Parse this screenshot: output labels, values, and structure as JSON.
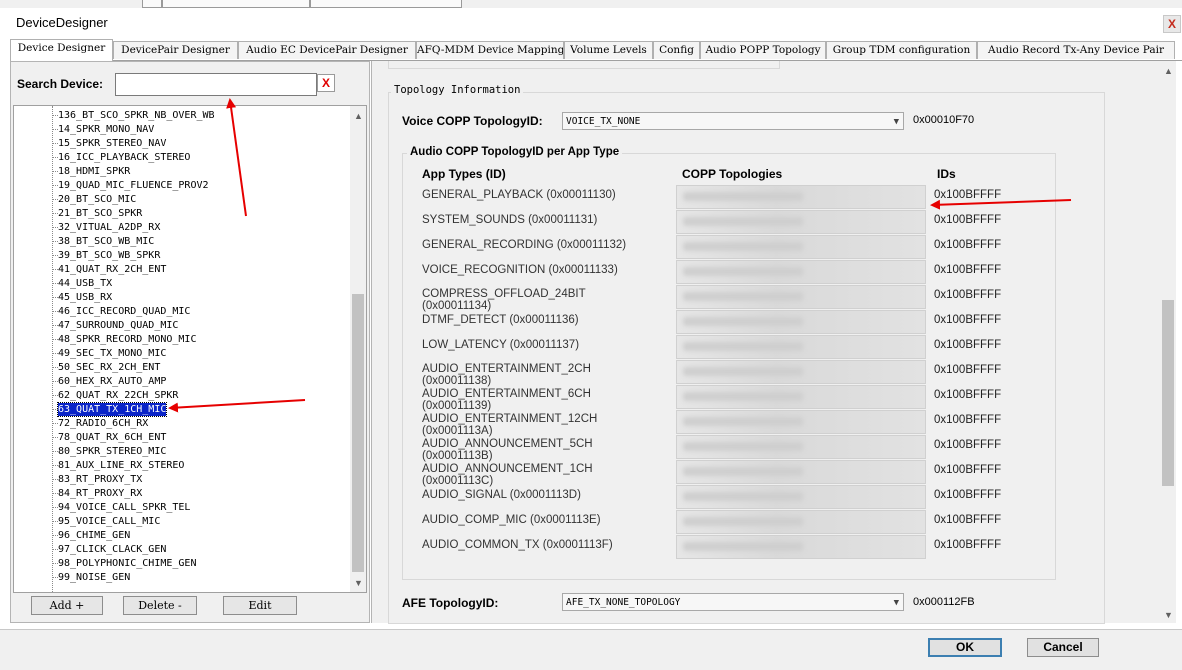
{
  "window": {
    "title": "DeviceDesigner",
    "close_label": "X"
  },
  "tabs": [
    "Device Designer",
    "DevicePair Designer",
    "Audio EC DevicePair Designer",
    "AFQ-MDM Device Mapping",
    "Volume Levels",
    "Config",
    "Audio POPP Topology",
    "Group TDM configuration",
    "Audio Record Tx-Any Device Pair"
  ],
  "search": {
    "label": "Search Device:",
    "value": "",
    "clear_label": "X"
  },
  "devices": [
    "136_BT_SCO_SPKR_NB_OVER_WB",
    "14_SPKR_MONO_NAV",
    "15_SPKR_STEREO_NAV",
    "16_ICC_PLAYBACK_STEREO",
    "18_HDMI_SPKR",
    "19_QUAD_MIC_FLUENCE_PROV2",
    "20_BT_SCO_MIC",
    "21_BT_SCO_SPKR",
    "32_VITUAL_A2DP_RX",
    "38_BT_SCO_WB_MIC",
    "39_BT_SCO_WB_SPKR",
    "41_QUAT_RX_2CH_ENT",
    "44_USB_TX",
    "45_USB_RX",
    "46_ICC_RECORD_QUAD_MIC",
    "47_SURROUND_QUAD_MIC",
    "48_SPKR_RECORD_MONO_MIC",
    "49_SEC_TX_MONO_MIC",
    "50_SEC_RX_2CH_ENT",
    "60_HEX_RX_AUTO_AMP",
    "62_QUAT_RX_22CH_SPKR",
    "63_QUAT_TX_1CH_MIC",
    "72_RADIO_6CH_RX",
    "78_QUAT_RX_6CH_ENT",
    "80_SPKR_STEREO_MIC",
    "81_AUX_LINE_RX_STEREO",
    "83_RT_PROXY_TX",
    "84_RT_PROXY_RX",
    "94_VOICE_CALL_SPKR_TEL",
    "95_VOICE_CALL_MIC",
    "96_CHIME_GEN",
    "97_CLICK_CLACK_GEN",
    "98_POLYPHONIC_CHIME_GEN",
    "99_NOISE_GEN"
  ],
  "selected_device": "63_QUAT_TX_1CH_MIC",
  "device_buttons": {
    "add": "Add +",
    "delete": "Delete -",
    "edit": "Edit"
  },
  "topology": {
    "group_label": "Topology Information",
    "voice_copp_label": "Voice COPP TopologyID:",
    "voice_copp_value": "VOICE_TX_NONE",
    "voice_copp_id": "0x00010F70",
    "audio_copp_group_label": "Audio COPP TopologyID per App Type",
    "col_app_types": "App Types (ID)",
    "col_copp": "COPP Topologies",
    "col_ids": "IDs",
    "app_types": [
      {
        "name": "GENERAL_PLAYBACK (0x00011130)",
        "id": "0x100BFFFF"
      },
      {
        "name": "SYSTEM_SOUNDS (0x00011131)",
        "id": "0x100BFFFF"
      },
      {
        "name": "GENERAL_RECORDING (0x00011132)",
        "id": "0x100BFFFF"
      },
      {
        "name": "VOICE_RECOGNITION (0x00011133)",
        "id": "0x100BFFFF"
      },
      {
        "name": "COMPRESS_OFFLOAD_24BIT (0x00011134)",
        "id": "0x100BFFFF"
      },
      {
        "name": "DTMF_DETECT (0x00011136)",
        "id": "0x100BFFFF"
      },
      {
        "name": "LOW_LATENCY (0x00011137)",
        "id": "0x100BFFFF"
      },
      {
        "name": "AUDIO_ENTERTAINMENT_2CH (0x00011138)",
        "id": "0x100BFFFF"
      },
      {
        "name": "AUDIO_ENTERTAINMENT_6CH (0x00011139)",
        "id": "0x100BFFFF"
      },
      {
        "name": "AUDIO_ENTERTAINMENT_12CH (0x0001113A)",
        "id": "0x100BFFFF"
      },
      {
        "name": "AUDIO_ANNOUNCEMENT_5CH (0x0001113B)",
        "id": "0x100BFFFF"
      },
      {
        "name": "AUDIO_ANNOUNCEMENT_1CH (0x0001113C)",
        "id": "0x100BFFFF"
      },
      {
        "name": "AUDIO_SIGNAL (0x0001113D)",
        "id": "0x100BFFFF"
      },
      {
        "name": "AUDIO_COMP_MIC (0x0001113E)",
        "id": "0x100BFFFF"
      },
      {
        "name": "AUDIO_COMMON_TX (0x0001113F)",
        "id": "0x100BFFFF"
      }
    ],
    "afe_label": "AFE TopologyID:",
    "afe_value": "AFE_TX_NONE_TOPOLOGY",
    "afe_id": "0x000112FB"
  },
  "dialog_buttons": {
    "ok": "OK",
    "cancel": "Cancel"
  },
  "colors": {
    "selection": "#0a24c8",
    "annotation_arrow": "#e60000",
    "clear_x": "#e00000"
  }
}
